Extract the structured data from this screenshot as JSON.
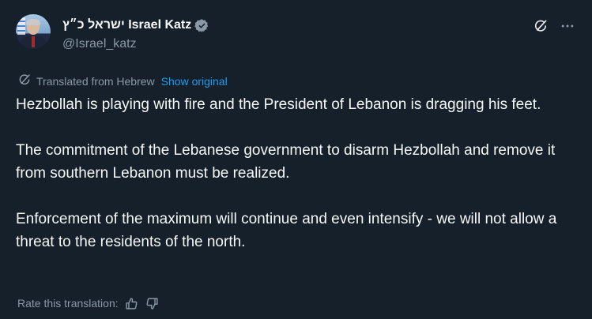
{
  "author": {
    "display_name": "ישראל כ״ץ Israel Katz",
    "handle": "@Israel_katz",
    "verified_icon": "verified-badge-icon",
    "avatar": "profile-photo"
  },
  "actions": {
    "grok_icon": "grok-icon",
    "more_icon": "more-options-icon"
  },
  "translation": {
    "label": "Translated from Hebrew",
    "show_original": "Show original"
  },
  "tweet": {
    "paragraphs": [
      "Hezbollah is playing with fire and the President of Lebanon is dragging his feet.",
      "The commitment of the Lebanese government to disarm Hezbollah and remove it from southern Lebanon must be realized.",
      "Enforcement of the maximum will continue and even intensify - we will not allow a threat to the residents of the north."
    ]
  },
  "rating": {
    "label": "Rate this translation:",
    "thumbs_up_icon": "thumbs-up-icon",
    "thumbs_down_icon": "thumbs-down-icon"
  },
  "colors": {
    "background": "#15202b",
    "text": "#f7f9f9",
    "secondary": "#8b98a5",
    "accent": "#1d9bf0"
  }
}
